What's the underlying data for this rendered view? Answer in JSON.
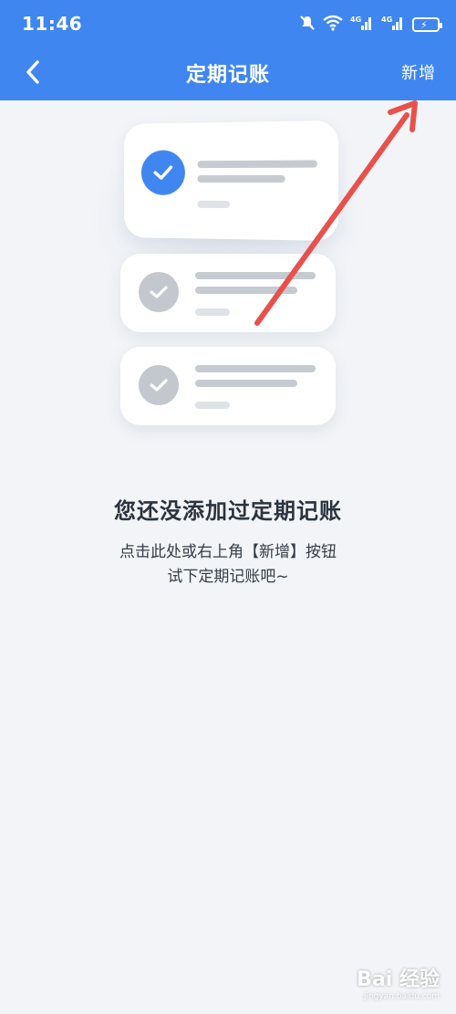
{
  "status_bar": {
    "time": "11:46",
    "icons": [
      "mute-icon",
      "wifi-icon",
      "signal-4g-icon",
      "signal-4g-icon",
      "battery-charging-icon"
    ]
  },
  "header": {
    "title": "定期记账",
    "back_icon": "chevron-left-icon",
    "add_label": "新增"
  },
  "empty_state": {
    "title": "您还没添加过定期记账",
    "desc_line1": "点击此处或右上角【新增】按钮",
    "desc_line2": "试下定期记账吧~"
  },
  "watermark": {
    "text": "Bai 经验",
    "sub": "jingyan.baidu.com"
  },
  "colors": {
    "primary": "#3f86f0",
    "background": "#f2f4f7",
    "annotation_arrow": "#e8514b",
    "placeholder_gray": "#c6cbd2"
  }
}
